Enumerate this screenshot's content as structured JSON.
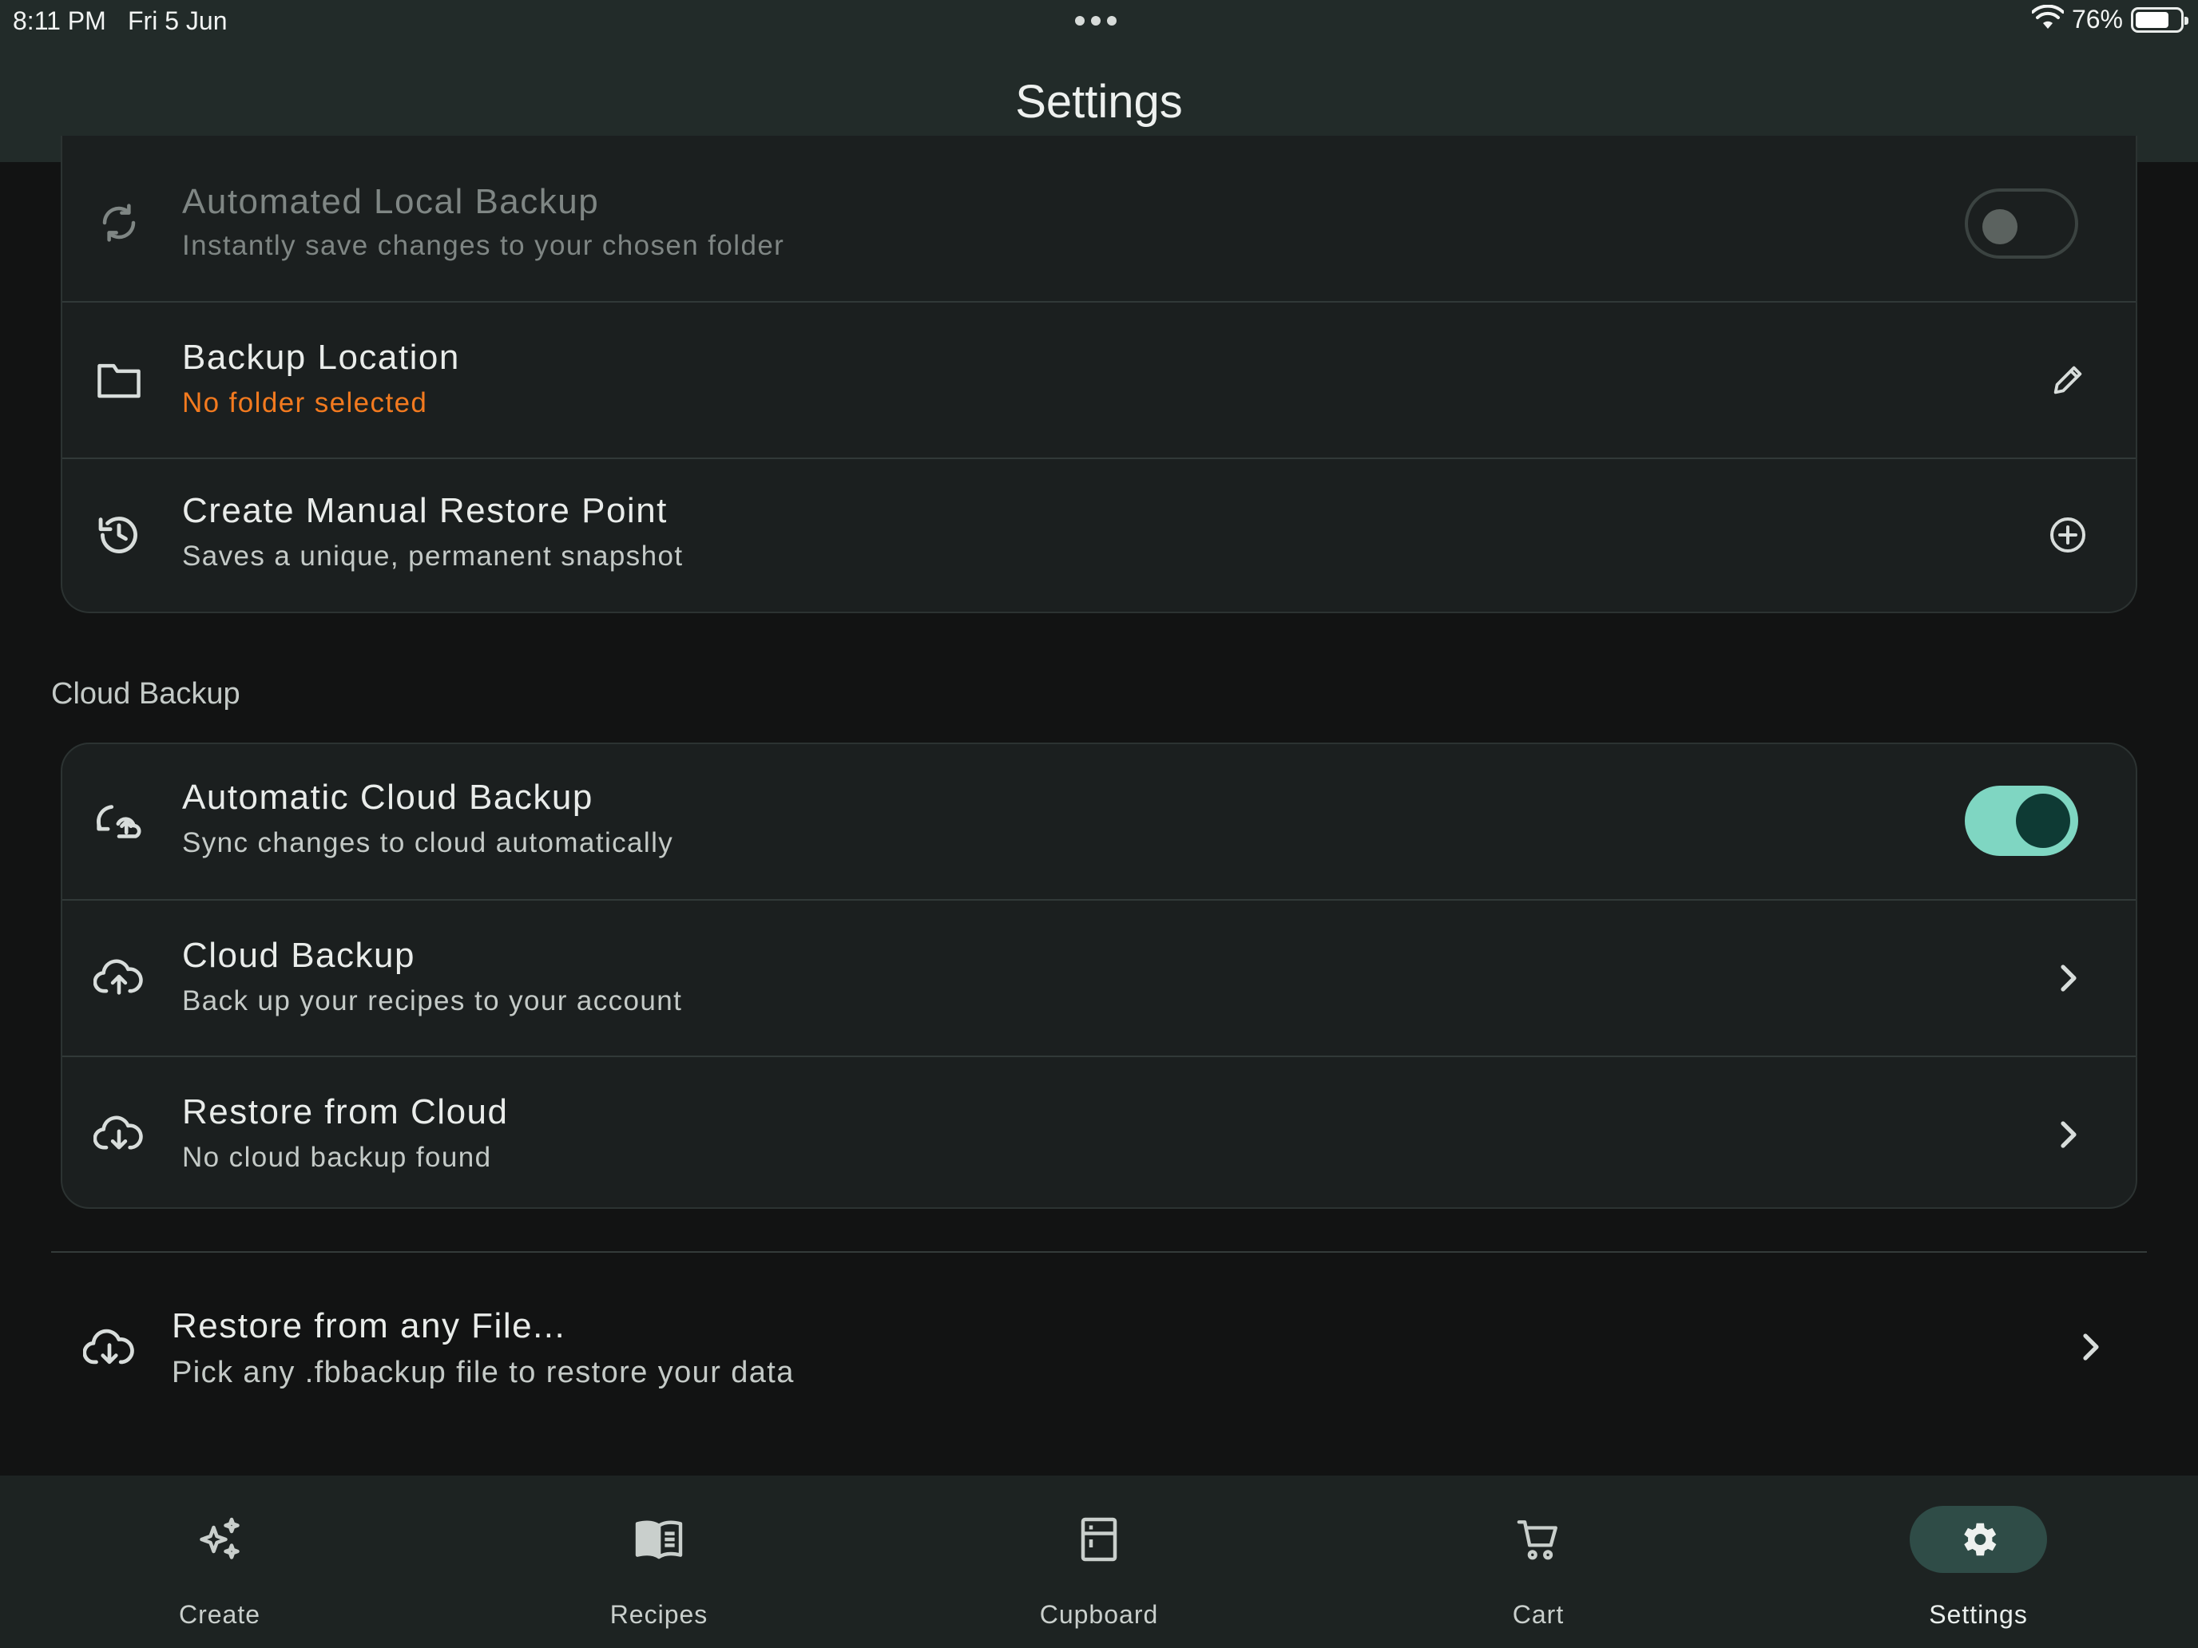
{
  "status_bar": {
    "time": "8:11 PM",
    "date": "Fri 5 Jun",
    "battery": "76%",
    "battery_level": 0.76
  },
  "header": {
    "title": "Settings"
  },
  "local_backup": {
    "rows": [
      {
        "title": "Automated Local Backup",
        "subtitle": "Instantly save changes to your chosen folder",
        "icon": "sync-icon",
        "toggle": false,
        "disabled": true
      },
      {
        "title": "Backup Location",
        "subtitle": "No folder selected",
        "icon": "folder-icon",
        "action": "edit-icon"
      },
      {
        "title": "Create Manual Restore Point",
        "subtitle": "Saves a unique, permanent snapshot",
        "icon": "history-icon",
        "action": "add-circle-icon"
      }
    ]
  },
  "cloud_backup": {
    "section_label": "Cloud Backup",
    "rows": [
      {
        "title": "Automatic Cloud Backup",
        "subtitle": "Sync changes to cloud automatically",
        "icon": "cloud-sync-icon",
        "toggle": true
      },
      {
        "title": "Cloud Backup",
        "subtitle": "Back up your recipes to your account",
        "icon": "cloud-upload-icon",
        "action": "chevron-right-icon"
      },
      {
        "title": "Restore from Cloud",
        "subtitle": "No cloud backup found",
        "icon": "cloud-download-icon",
        "action": "chevron-right-icon"
      }
    ]
  },
  "file_restore": {
    "title": "Restore from any File...",
    "subtitle": "Pick any .fbbackup file to restore your data",
    "icon": "cloud-download-icon"
  },
  "bottom_nav": [
    {
      "label": "Create",
      "icon": "sparkles-icon",
      "active": false
    },
    {
      "label": "Recipes",
      "icon": "book-icon",
      "active": false
    },
    {
      "label": "Cupboard",
      "icon": "cupboard-icon",
      "active": false
    },
    {
      "label": "Cart",
      "icon": "cart-icon",
      "active": false
    },
    {
      "label": "Settings",
      "icon": "gear-icon",
      "active": true
    }
  ],
  "colors": {
    "accent": "#7fd6c2",
    "warning": "#f37a1f",
    "background": "#121313",
    "surface": "#1b1f1f"
  }
}
